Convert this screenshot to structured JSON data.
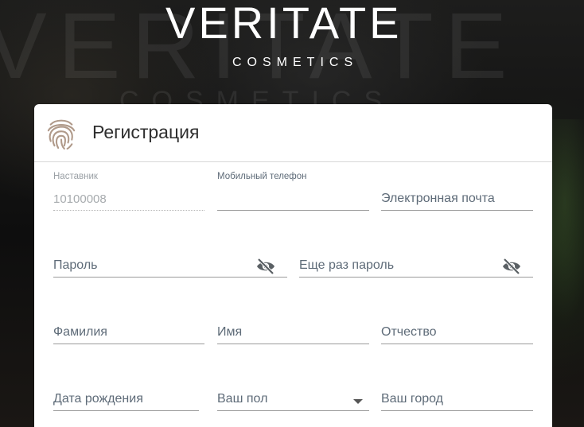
{
  "brand": {
    "name": "VERITATE",
    "subtitle": "COSMETICS",
    "background_word": "VERITATE",
    "background_sub": "COSMETICS"
  },
  "card": {
    "title": "Регистрация",
    "icon": "fingerprint-icon"
  },
  "form": {
    "mentor": {
      "label": "Наставник",
      "value": "10100008"
    },
    "phone": {
      "label": "Мобильный телефон",
      "value": ""
    },
    "email": {
      "placeholder": "Электронная почта"
    },
    "password": {
      "placeholder": "Пароль",
      "icon": "eye-off-icon"
    },
    "password_repeat": {
      "placeholder": "Еще раз пароль",
      "icon": "eye-off-icon"
    },
    "last_name": {
      "placeholder": "Фамилия"
    },
    "first_name": {
      "placeholder": "Имя"
    },
    "middle_name": {
      "placeholder": "Отчество"
    },
    "birth_date": {
      "placeholder": "Дата рождения"
    },
    "gender": {
      "placeholder": "Ваш пол",
      "icon": "caret-down-icon"
    },
    "city": {
      "placeholder": "Ваш город"
    }
  },
  "colors": {
    "icon_fingerprint": "#b09a8a",
    "text_field": "#5e6b78",
    "card_bg": "#ffffff"
  }
}
